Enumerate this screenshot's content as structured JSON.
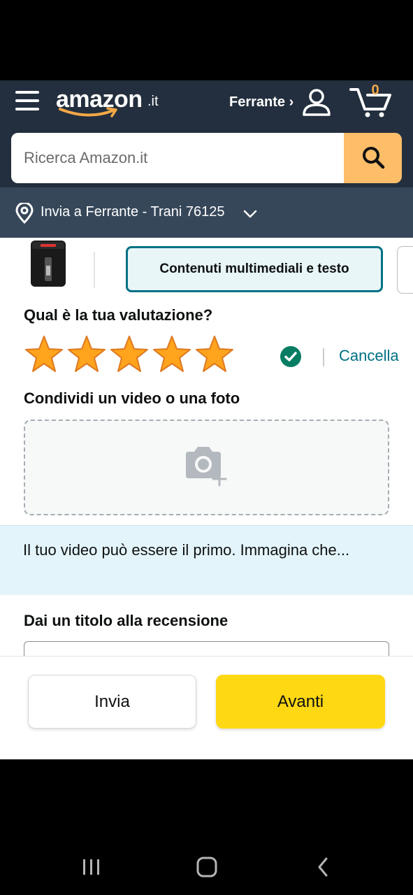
{
  "header": {
    "logo_word": "amazon",
    "logo_tld": ".it",
    "account_label": "Ferrante ›",
    "cart_count": "0"
  },
  "search": {
    "placeholder": "Ricerca Amazon.it"
  },
  "delivery": {
    "text": "Invia a Ferrante - Trani 76125"
  },
  "review": {
    "tab_active_label": "Contenuti multimediali e testo",
    "rating_question": "Qual è la tua valutazione?",
    "rating_value": 5,
    "rating_max": 5,
    "cancel_label": "Cancella",
    "share_label": "Condividi un video o una foto",
    "info_text": "Il tuo video può essere il primo. Immagina che...",
    "title_label": "Dai un titolo alla recensione"
  },
  "actions": {
    "submit_label": "Invia",
    "next_label": "Avanti"
  },
  "colors": {
    "header_bg": "#232f3e",
    "delivery_bg": "#37475a",
    "search_button": "#febd69",
    "accent_teal": "#007185",
    "star": "#ffa41c",
    "next_button": "#ffd814",
    "info_banner": "#e3f5fb"
  },
  "icons": {
    "menu": "hamburger-icon",
    "account": "user-icon",
    "cart": "cart-icon",
    "search": "search-icon",
    "location": "location-pin-icon",
    "check": "check-circle-icon",
    "upload": "camera-plus-icon"
  }
}
